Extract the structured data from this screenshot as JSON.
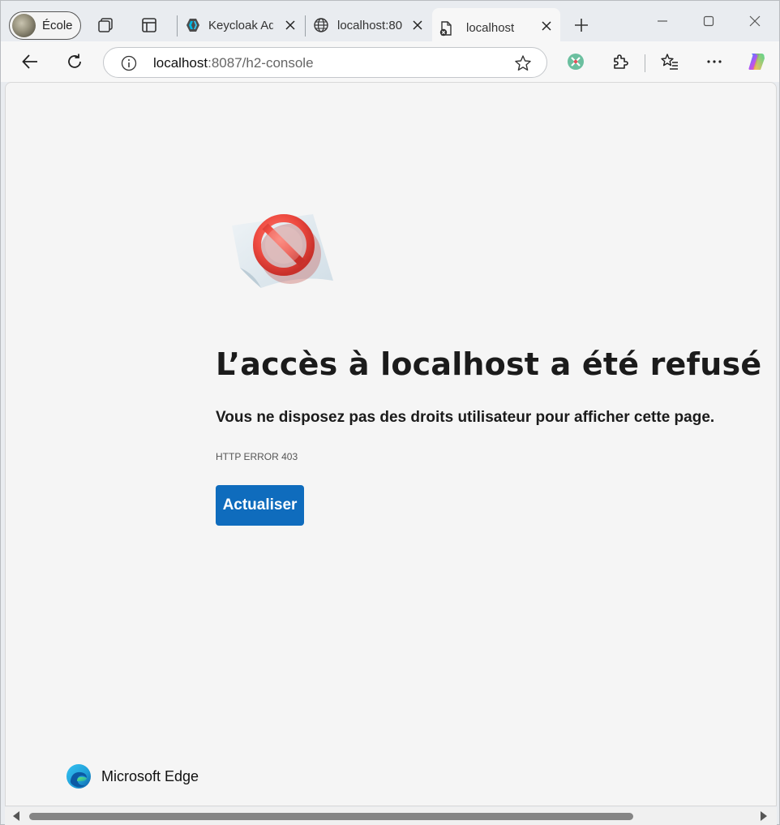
{
  "profile": {
    "label": "École"
  },
  "tabs": [
    {
      "label": "Keycloak Ad",
      "icon": "keycloak-icon"
    },
    {
      "label": "localhost:80",
      "icon": "globe-icon"
    },
    {
      "label": "localhost",
      "icon": "error-page-icon",
      "active": true
    }
  ],
  "address_bar": {
    "host": "localhost",
    "rest": ":8087/h2-console"
  },
  "page": {
    "title": "L’accès à localhost a été refusé",
    "subtitle": "Vous ne disposez pas des droits utilisateur pour afficher cette page.",
    "error_code": "HTTP ERROR 403",
    "reload_button": "Actualiser"
  },
  "brand": {
    "name": "Microsoft Edge"
  },
  "colors": {
    "accent": "#0f6cbd",
    "forbidden_red": "#e8403a",
    "background": "#f5f5f5"
  }
}
